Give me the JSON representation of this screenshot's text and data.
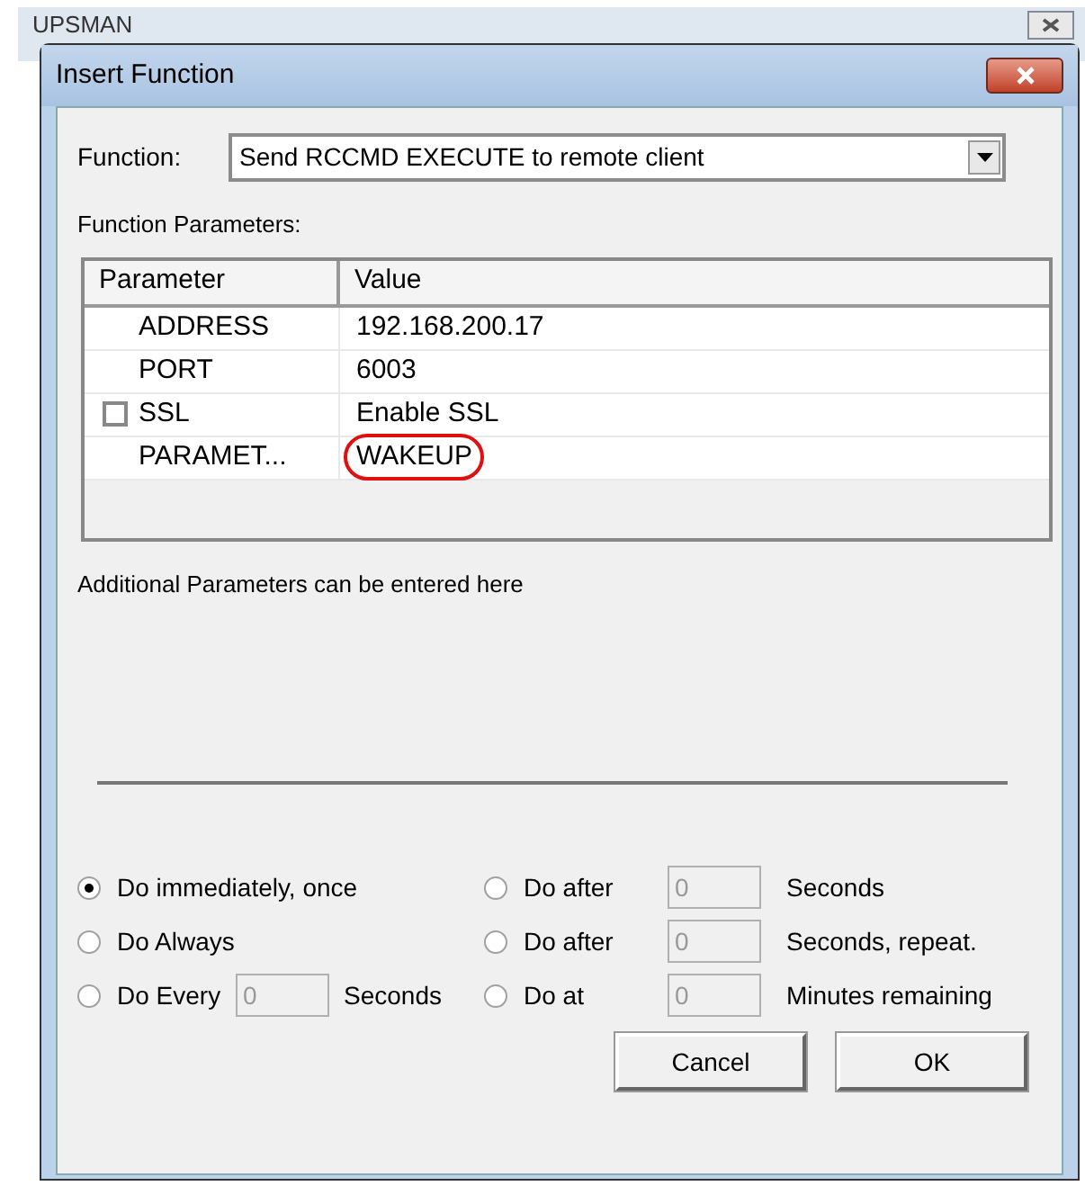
{
  "parent_window": {
    "title": "UPSMAN"
  },
  "dialog": {
    "title": "Insert Function"
  },
  "function_field": {
    "label": "Function:",
    "value": "Send RCCMD EXECUTE to remote client"
  },
  "parameters_label": "Function Parameters:",
  "table": {
    "columns": [
      "Parameter",
      "Value"
    ],
    "rows": [
      {
        "kind": "plain",
        "parameter": "ADDRESS",
        "value": "192.168.200.17",
        "highlighted": false
      },
      {
        "kind": "plain",
        "parameter": "PORT",
        "value": "6003",
        "highlighted": false
      },
      {
        "kind": "checkbox",
        "checked": false,
        "parameter": "SSL",
        "value": "Enable SSL",
        "highlighted": false
      },
      {
        "kind": "plain",
        "parameter": "PARAMET...",
        "value": "WAKEUP",
        "highlighted": true
      }
    ]
  },
  "additional_note": "Additional Parameters can be entered here",
  "schedule_options": [
    {
      "label": "Do immediately, once",
      "selected": true
    },
    {
      "label": "Do after",
      "field": "0",
      "unit": "Seconds",
      "selected": false
    },
    {
      "label": "Do Always",
      "selected": false
    },
    {
      "label": "Do after",
      "field": "0",
      "unit": "Seconds, repeat.",
      "selected": false
    },
    {
      "label": "Do Every",
      "field": "0",
      "unit": "Seconds",
      "selected": false
    },
    {
      "label": "Do at",
      "field": "0",
      "unit": "Minutes remaining",
      "selected": false
    }
  ],
  "buttons": [
    "Cancel",
    "OK"
  ]
}
